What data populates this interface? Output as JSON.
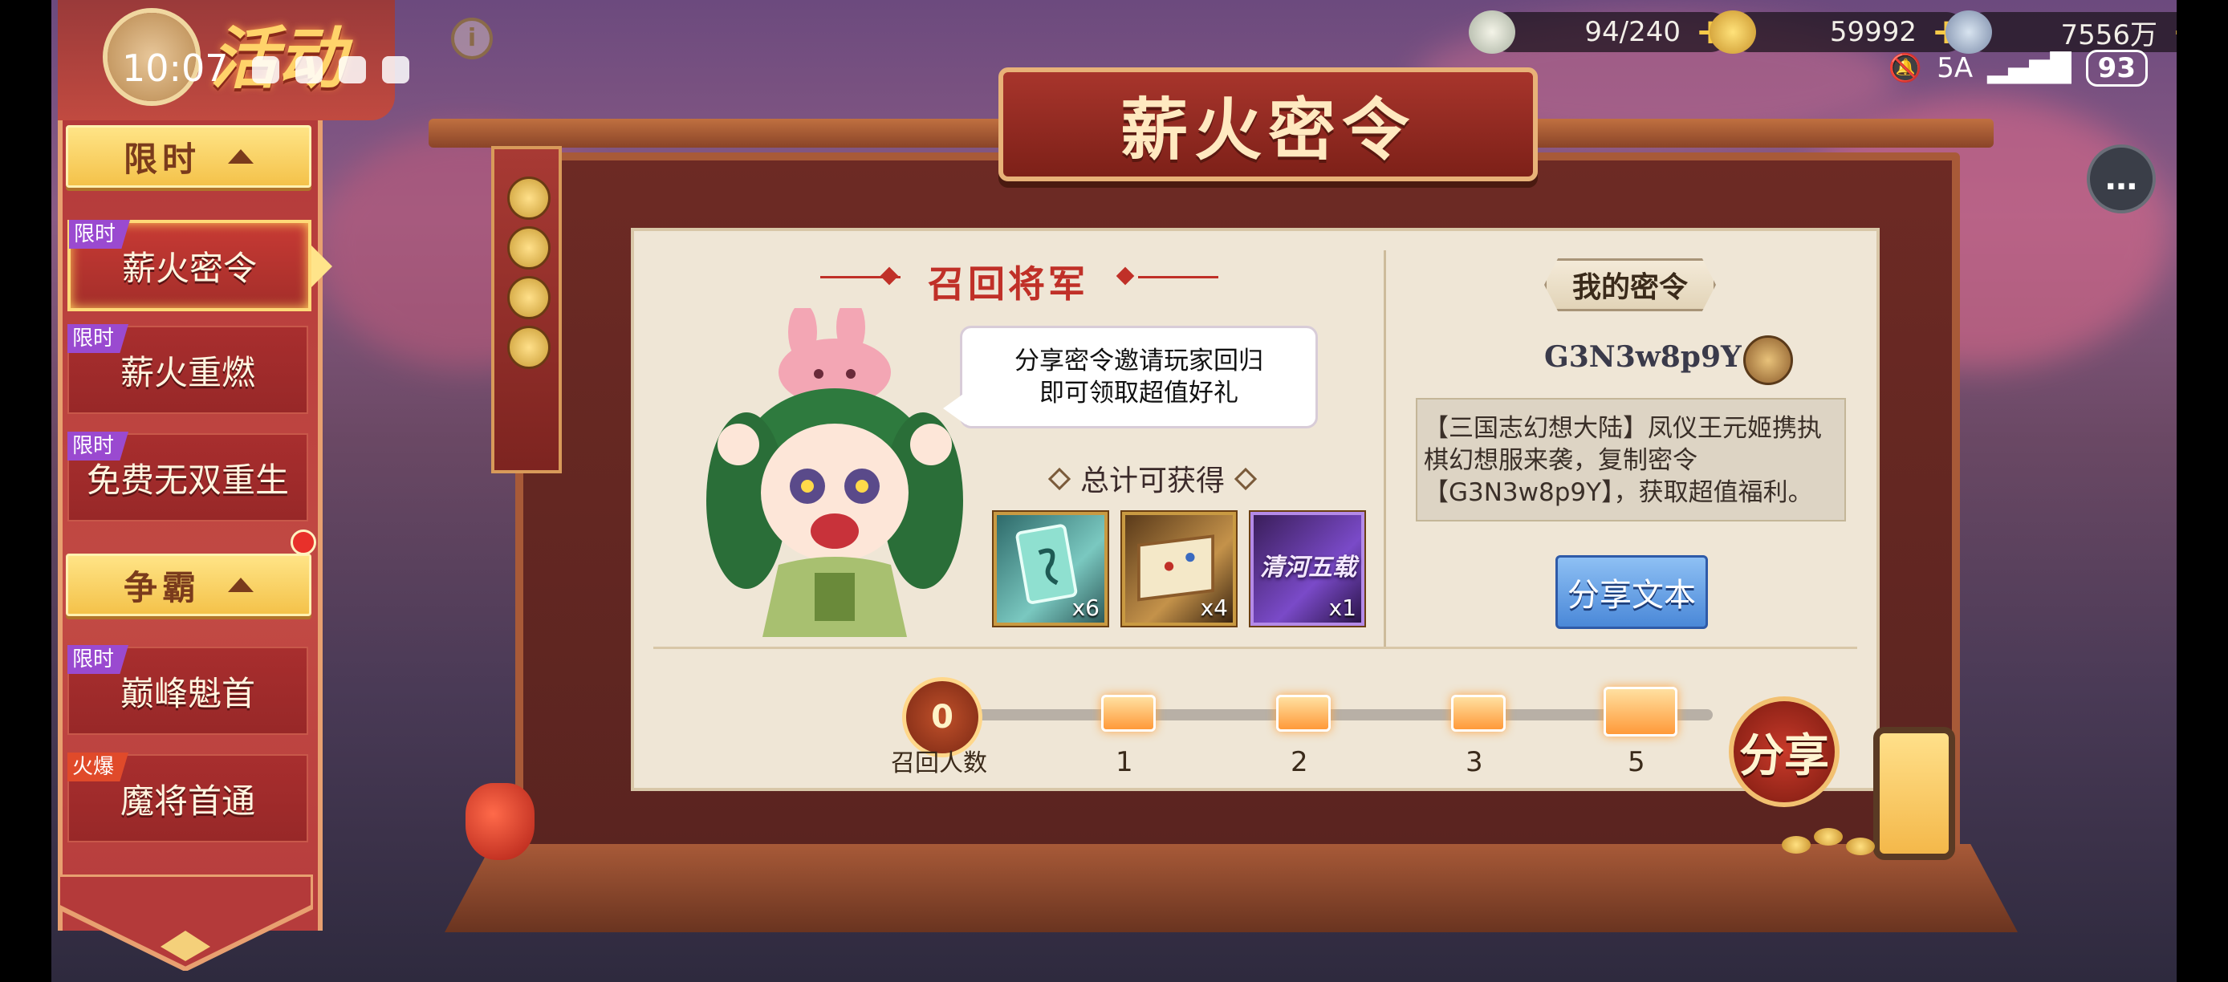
{
  "status_bar": {
    "time": "10:07",
    "network": "5A",
    "battery": "93"
  },
  "currencies": [
    {
      "value": "94/240",
      "icon": "stamina-icon"
    },
    {
      "value": "59992",
      "icon": "gold-ingot-icon"
    },
    {
      "value": "7556万",
      "icon": "copper-coin-icon"
    }
  ],
  "sidebar": {
    "title": "活动",
    "groups": [
      {
        "label": "限时",
        "items": [
          {
            "tag": "限时",
            "label": "薪火密令",
            "active": true
          },
          {
            "tag": "限时",
            "label": "薪火重燃"
          },
          {
            "tag": "限时",
            "label": "免费无双重生"
          }
        ]
      },
      {
        "label": "争霸",
        "items": [
          {
            "tag": "限时",
            "label": "巅峰魁首"
          },
          {
            "tag": "火爆",
            "label": "魔将首通"
          }
        ]
      }
    ]
  },
  "board": {
    "title": "薪火密令"
  },
  "recall": {
    "title": "召回将军",
    "bubble_line1": "分享密令邀请玩家回归",
    "bubble_line2": "即可领取超值好礼",
    "total_label": "总计可获得",
    "rewards": [
      {
        "count": "x6",
        "icon": "jade-card-icon"
      },
      {
        "count": "x4",
        "icon": "scroll-map-icon"
      },
      {
        "count": "x1",
        "icon": "skin-badge-icon",
        "label": "清河五载"
      }
    ],
    "progress": {
      "current": "0",
      "label": "召回人数",
      "milestones": [
        "1",
        "2",
        "3",
        "5"
      ]
    }
  },
  "my_code": {
    "title": "我的密令",
    "code": "G3N3w8p9Y",
    "share_text": "【三国志幻想大陆】凤仪王元姬携执棋幻想服来袭，复制密令【G3N3w8p9Y】，获取超值福利。",
    "share_button": "分享文本"
  },
  "share_circle_label": "分享",
  "colors": {
    "sidebar_red": "#b43a3a",
    "title_red": "#c03028",
    "panel_bg": "#efe6d6",
    "share_blue": "#4a88d8",
    "gold": "#f4c24a"
  }
}
